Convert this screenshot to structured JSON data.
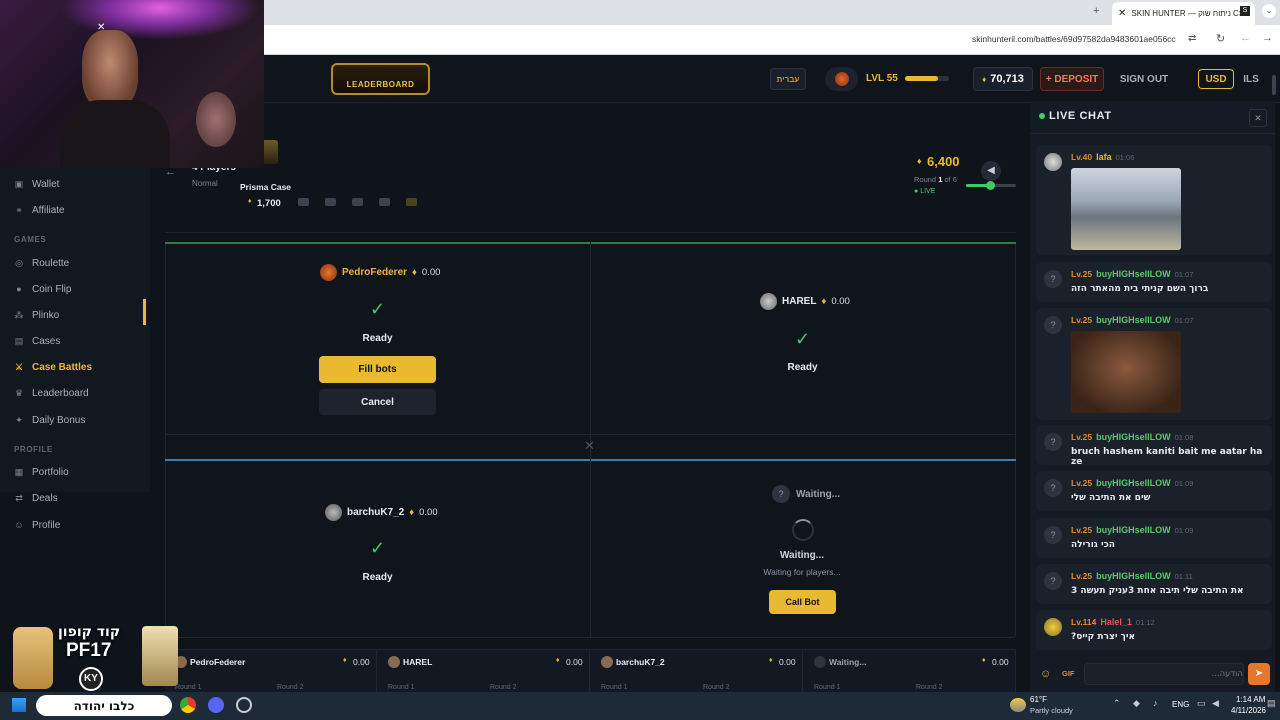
{
  "browser": {
    "tab_title": "SKIN HUNTER — ניתוח שוק CS",
    "url": "skinhunteril.com/battles/69d97582da9483601ae056cc"
  },
  "topnav": {
    "leaderboard_label": "LEADERBOARD",
    "language_label": "עברית",
    "level_label": "LVL 55",
    "level_progress": 0.75,
    "balance": "70,713",
    "deposit_label": "+ DEPOSIT",
    "signout_label": "SIGN OUT",
    "currency_usd": "USD",
    "currency_ils": "ILS"
  },
  "sidebar": {
    "items_top": [
      {
        "label": "Wallet",
        "icon": "wallet-icon"
      },
      {
        "label": "Affiliate",
        "icon": "affiliate-icon"
      }
    ],
    "games_heading": "GAMES",
    "games": [
      {
        "label": "Roulette",
        "icon": "roulette-icon"
      },
      {
        "label": "Coin Flip",
        "icon": "coin-icon"
      },
      {
        "label": "Plinko",
        "icon": "plinko-icon"
      },
      {
        "label": "Cases",
        "icon": "case-icon"
      },
      {
        "label": "Case Battles",
        "icon": "swords-icon",
        "active": true
      },
      {
        "label": "Leaderboard",
        "icon": "trophy-icon"
      },
      {
        "label": "Daily Bonus",
        "icon": "gift-icon"
      }
    ],
    "profile_heading": "PROFILE",
    "profile": [
      {
        "label": "Portfolio",
        "icon": "portfolio-icon"
      },
      {
        "label": "Deals",
        "icon": "deals-icon"
      },
      {
        "label": "Profile",
        "icon": "user-icon"
      }
    ]
  },
  "battle": {
    "players_label": "4 Players",
    "mode_label": "Normal",
    "case_name": "Prisma Case",
    "case_price": "1,700",
    "total_value": "6,400",
    "round_prefix": "Round",
    "round_current": "1",
    "round_of": "of 6",
    "live_label": "LIVE",
    "players": [
      {
        "name": "PedroFederer",
        "amount": "0.00",
        "status": "Ready",
        "fill_bots": "Fill bots",
        "cancel": "Cancel"
      },
      {
        "name": "HAREL",
        "amount": "0.00",
        "status": "Ready"
      },
      {
        "name": "barchuK7_2",
        "amount": "0.00",
        "status": "Ready"
      },
      {
        "name": "Waiting...",
        "amount": "",
        "status": "Waiting...",
        "substatus": "Waiting for players...",
        "call_bot": "Call Bot"
      }
    ],
    "bottom_row": [
      {
        "name": "PedroFederer",
        "amount": "0.00",
        "r1": "Round 1",
        "r2": "Round 2"
      },
      {
        "name": "HAREL",
        "amount": "0.00",
        "r1": "Round 1",
        "r2": "Round 2"
      },
      {
        "name": "barchuK7_2",
        "amount": "0.00",
        "r1": "Round 1",
        "r2": "Round 2"
      },
      {
        "name": "Waiting...",
        "amount": "0.00",
        "r1": "Round 1",
        "r2": "Round 2"
      }
    ]
  },
  "chat": {
    "title": "LIVE CHAT",
    "input_placeholder": "הודעה...",
    "gif_label": "GIF",
    "messages": [
      {
        "level": "Lv.40",
        "user": "lafa",
        "time": "01:06",
        "text": "",
        "image": true,
        "user_color": "#e8b931"
      },
      {
        "level": "Lv.25",
        "user": "buyHIGHsellLOW",
        "time": "01:07",
        "text": "ברוך השם קניתי בית מהאתר הזה"
      },
      {
        "level": "Lv.25",
        "user": "buyHIGHsellLOW",
        "time": "01:07",
        "text": "",
        "image": true
      },
      {
        "level": "Lv.25",
        "user": "buyHIGHsellLOW",
        "time": "01:08",
        "text": "bruch hashem kaniti bait me aatar ha ze"
      },
      {
        "level": "Lv.25",
        "user": "buyHIGHsellLOW",
        "time": "01:09",
        "text": "שים את התיבה שלי"
      },
      {
        "level": "Lv.25",
        "user": "buyHIGHsellLOW",
        "time": "01:09",
        "text": "הכי גורילה"
      },
      {
        "level": "Lv.25",
        "user": "buyHIGHsellLOW",
        "time": "01:11",
        "text": "את התיבה שלי תיבה אחת 3עניק תעשה 3"
      },
      {
        "level": "Lv.114",
        "user": "Halel_1",
        "time": "01:12",
        "text": "איך יצרת קייס?",
        "user_color": "#e05858"
      }
    ]
  },
  "stream_overlay": {
    "promo_code_label": "קוד קופון",
    "promo_code": "PF17",
    "brand_text": "כלבו יהודה",
    "ky_label": "KY"
  },
  "taskbar": {
    "weather_temp": "61°F",
    "weather_desc": "Partly cloudy",
    "lang": "ENG",
    "time": "1:14 AM",
    "date": "4/11/2026"
  },
  "colors": {
    "accent": "#e8b931",
    "green": "#3ecb64",
    "bg": "#0f131a",
    "blue_line": "#3b7fb5"
  }
}
